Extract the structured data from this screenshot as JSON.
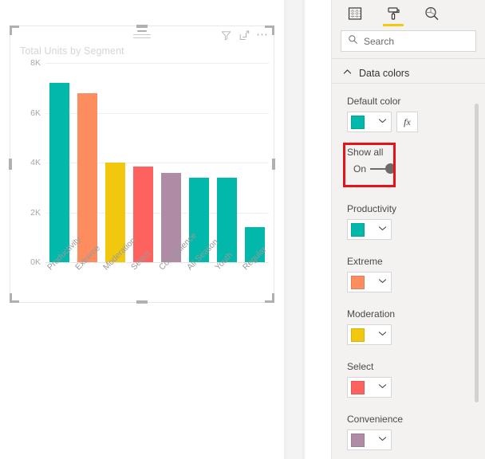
{
  "canvas": {
    "visual": {
      "title": "Total Units by Segment",
      "actions": [
        {
          "name": "filter-icon",
          "label": "Filters"
        },
        {
          "name": "focus-mode-icon",
          "label": "Focus mode"
        },
        {
          "name": "more-options-icon",
          "label": "More options"
        }
      ]
    }
  },
  "chart_data": {
    "type": "bar",
    "title": "Total Units by Segment",
    "xlabel": "",
    "ylabel": "",
    "categories": [
      "Productivity",
      "Extreme",
      "Moderation",
      "Select",
      "Convenience",
      "All Season",
      "Youth",
      "Regular"
    ],
    "values": [
      7200,
      6800,
      4000,
      3850,
      3600,
      3400,
      3400,
      1400
    ],
    "colors": [
      "#01B8AA",
      "#FD8D5E",
      "#F2C80F",
      "#FD625E",
      "#B08BA5",
      "#01B8AA",
      "#01B8AA",
      "#01B8AA"
    ],
    "ylim": [
      0,
      8000
    ],
    "yticks": [
      0,
      2000,
      4000,
      6000,
      8000
    ],
    "ytick_labels": [
      "0K",
      "2K",
      "4K",
      "6K",
      "8K"
    ],
    "grid": true,
    "legend": "none"
  },
  "pane": {
    "tabs": [
      {
        "name": "fields-tab",
        "label": "Fields",
        "selected": false
      },
      {
        "name": "format-tab",
        "label": "Format",
        "selected": true
      },
      {
        "name": "analytics-tab",
        "label": "Analytics",
        "selected": false
      }
    ],
    "search": {
      "placeholder": "Search",
      "value": "Search"
    },
    "section": {
      "title": "Data colors",
      "expanded": true
    },
    "default_color": {
      "label": "Default color",
      "color": "#01B8AA",
      "fx_label": "fx"
    },
    "show_all": {
      "label": "Show all",
      "state": "On",
      "highlighted": true
    },
    "series": [
      {
        "label": "Productivity",
        "color": "#01B8AA"
      },
      {
        "label": "Extreme",
        "color": "#FD8D5E"
      },
      {
        "label": "Moderation",
        "color": "#F2C80F"
      },
      {
        "label": "Select",
        "color": "#FD625E"
      },
      {
        "label": "Convenience",
        "color": "#B08BA5"
      }
    ]
  },
  "theme": {
    "accent": "#F2C811",
    "highlight": "#E8131A",
    "pane_bg": "#F3F2F1"
  }
}
